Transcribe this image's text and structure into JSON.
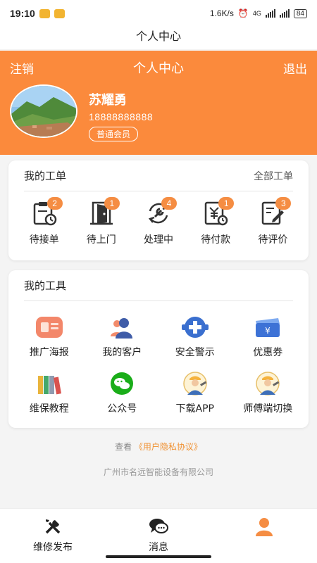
{
  "status_bar": {
    "time": "19:10",
    "speed": "1.6K/s",
    "network": "4G",
    "battery": "84"
  },
  "title_bar": {
    "title": "个人中心"
  },
  "header": {
    "left_label": "注销",
    "title": "个人中心",
    "right_label": "退出",
    "user": {
      "name": "苏耀勇",
      "phone": "18888888888",
      "level": "普通会员"
    },
    "bg_color": "#fb8a3c"
  },
  "orders": {
    "title": "我的工单",
    "all_label": "全部工单",
    "items": [
      {
        "label": "待接单",
        "count": "2",
        "icon": "clipboard-clock-icon"
      },
      {
        "label": "待上门",
        "count": "1",
        "icon": "door-icon"
      },
      {
        "label": "处理中",
        "count": "4",
        "icon": "wrench-cycle-icon"
      },
      {
        "label": "待付款",
        "count": "1",
        "icon": "yuan-bill-icon"
      },
      {
        "label": "待评价",
        "count": "3",
        "icon": "edit-note-icon"
      }
    ]
  },
  "tools": {
    "title": "我的工具",
    "items": [
      {
        "label": "推广海报",
        "icon": "poster-icon"
      },
      {
        "label": "我的客户",
        "icon": "customers-icon"
      },
      {
        "label": "安全警示",
        "icon": "safety-icon"
      },
      {
        "label": "优惠券",
        "icon": "coupon-icon"
      },
      {
        "label": "维保教程",
        "icon": "books-icon"
      },
      {
        "label": "公众号",
        "icon": "wechat-icon"
      },
      {
        "label": "下载APP",
        "icon": "worker-avatar-icon"
      },
      {
        "label": "师傅端切换",
        "icon": "worker-avatar-icon"
      }
    ]
  },
  "footer": {
    "privacy_prefix": "查看",
    "privacy_link": "《用户隐私协议》",
    "company": "广州市名远智能设备有限公司"
  },
  "tabbar": {
    "items": [
      {
        "label": "维修发布",
        "icon": "tools-icon"
      },
      {
        "label": "消息",
        "icon": "chat-icon"
      },
      {
        "label": "",
        "icon": "profile-icon"
      }
    ]
  },
  "accent_color": "#f58d43"
}
